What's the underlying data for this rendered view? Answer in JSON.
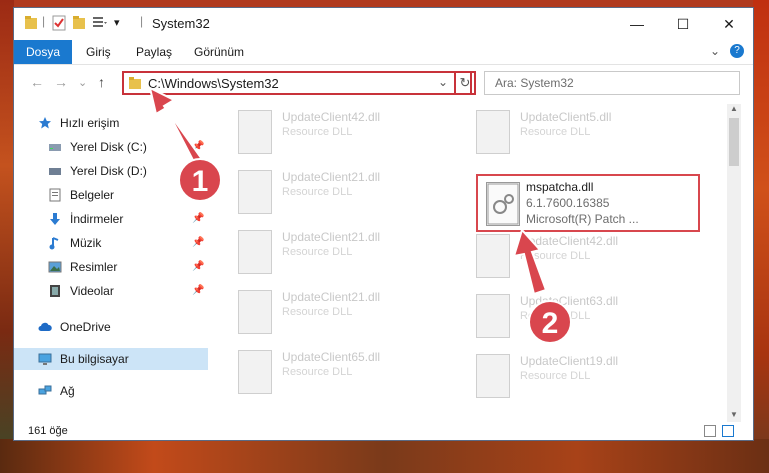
{
  "window": {
    "title": "System32",
    "controls": {
      "minimize": "—",
      "maximize": "☐",
      "close": "✕"
    }
  },
  "ribbon": {
    "tabs": [
      "Dosya",
      "Giriş",
      "Paylaş",
      "Görünüm"
    ],
    "expand": "⌄",
    "help": "?"
  },
  "address": {
    "path": "C:\\Windows\\System32",
    "search_placeholder": "Ara: System32",
    "back": "←",
    "forward": "→",
    "recent": "⌄",
    "up": "↑",
    "dropdown": "⌄",
    "refresh": "↻"
  },
  "nav": {
    "items": [
      {
        "label": "Hızlı erişim",
        "icon": "star-icon",
        "pinned": false
      },
      {
        "label": "Yerel Disk (C:)",
        "icon": "drive-icon",
        "pinned": true
      },
      {
        "label": "Yerel Disk (D:)",
        "icon": "drive-icon",
        "pinned": false
      },
      {
        "label": "Belgeler",
        "icon": "documents-icon",
        "pinned": false
      },
      {
        "label": "İndirmeler",
        "icon": "download-icon",
        "pinned": true
      },
      {
        "label": "Müzik",
        "icon": "music-icon",
        "pinned": true
      },
      {
        "label": "Resimler",
        "icon": "pictures-icon",
        "pinned": true
      },
      {
        "label": "Videolar",
        "icon": "videos-icon",
        "pinned": true
      },
      {
        "label": "OneDrive",
        "icon": "cloud-icon",
        "pinned": false
      },
      {
        "label": "Bu bilgisayar",
        "icon": "computer-icon",
        "pinned": false
      },
      {
        "label": "Ağ",
        "icon": "network-icon",
        "pinned": false
      }
    ],
    "pin_glyph": "📌"
  },
  "files": {
    "left": [
      {
        "name": "UpdateClient42.dll",
        "type": "Resource DLL"
      },
      {
        "name": "UpdateClient21.dll",
        "type": "Resource DLL"
      },
      {
        "name": "UpdateClient21.dll",
        "type": "Resource DLL"
      },
      {
        "name": "UpdateClient21.dll",
        "type": "Resource DLL"
      },
      {
        "name": "UpdateClient65.dll",
        "type": "Resource DLL"
      }
    ],
    "right": [
      {
        "name": "UpdateClient5.dll",
        "type": "Resource DLL"
      },
      {
        "name": "UpdateClient42.dll",
        "type": "Resource DLL"
      },
      {
        "name": "UpdateClient63.dll",
        "type": "Resource DLL"
      },
      {
        "name": "UpdateClient19.dll",
        "type": "Resource DLL"
      }
    ],
    "highlighted": {
      "name": "mspatcha.dll",
      "version": "6.1.7600.16385",
      "description": "Microsoft(R) Patch ..."
    }
  },
  "status": {
    "count": "161 öğe"
  },
  "annotations": {
    "step1": "1",
    "step2": "2"
  },
  "colors": {
    "accent": "#1a79cf",
    "highlight": "#d8474e"
  }
}
